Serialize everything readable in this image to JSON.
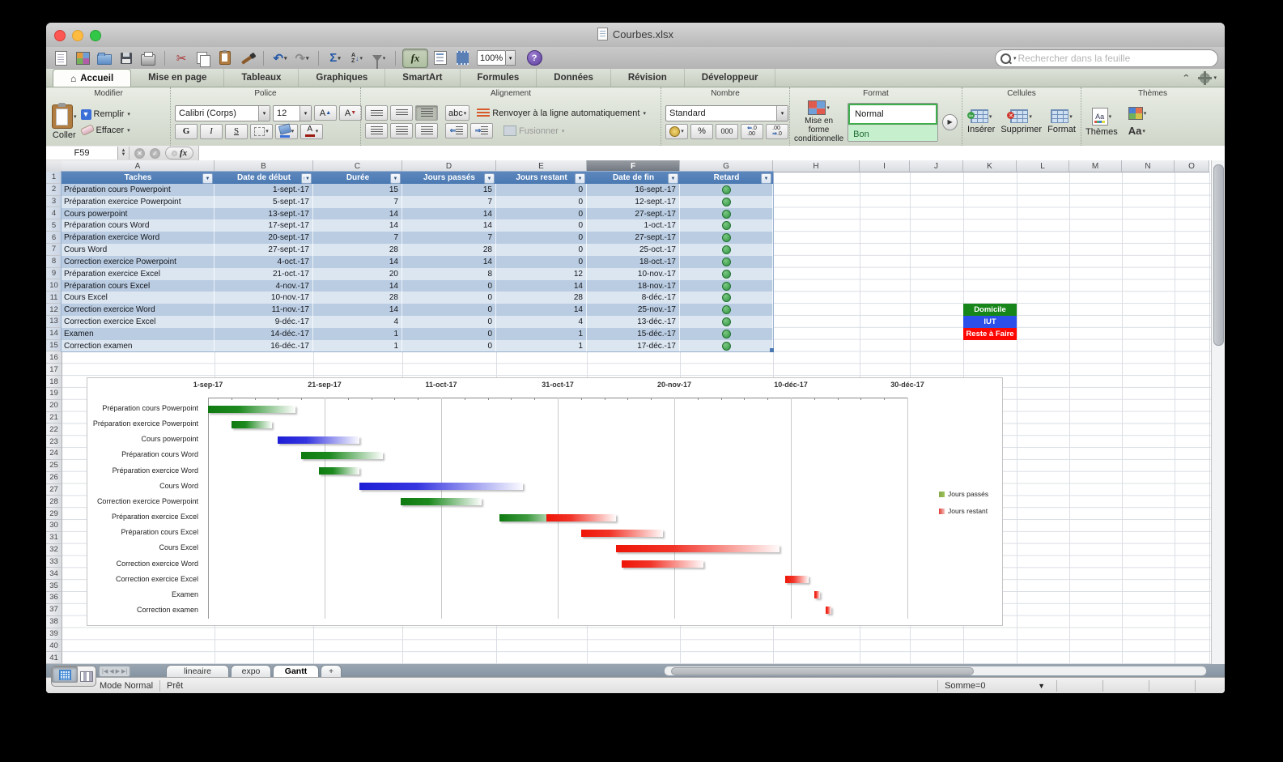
{
  "window": {
    "title": "Courbes.xlsx"
  },
  "toolbar": {
    "zoom_level": "100%",
    "search_placeholder": "Rechercher dans la feuille",
    "icons": {
      "cut": "✂",
      "undo": "↶",
      "redo": "↷",
      "autosum": "Σ",
      "fx": "fx",
      "help": "?",
      "sort_a": "A",
      "sort_z": "Z"
    }
  },
  "ribbon_tabs": {
    "items": [
      "Accueil",
      "Mise en page",
      "Tableaux",
      "Graphiques",
      "SmartArt",
      "Formules",
      "Données",
      "Révision",
      "Développeur"
    ],
    "active": "Accueil"
  },
  "ribbon": {
    "groups": {
      "modifier": {
        "label": "Modifier",
        "paste": "Coller",
        "fill": "Remplir",
        "clear": "Effacer"
      },
      "police": {
        "label": "Police",
        "font_name": "Calibri (Corps)",
        "font_size": "12",
        "bold": "G",
        "italic": "I",
        "underline": "S"
      },
      "alignement": {
        "label": "Alignement",
        "abc": "abc",
        "wrap": "Renvoyer à la ligne automatiquement",
        "merge": "Fusionner"
      },
      "nombre": {
        "label": "Nombre",
        "format": "Standard",
        "percent": "%",
        "thousands": "000"
      },
      "format": {
        "label": "Format",
        "cond_line1": "Mise en forme",
        "cond_line2": "conditionnelle",
        "style_normal": "Normal",
        "style_bon": "Bon"
      },
      "cellules": {
        "label": "Cellules",
        "insert": "Insérer",
        "delete": "Supprimer",
        "format": "Format"
      },
      "themes": {
        "label": "Thèmes",
        "themes": "Thèmes",
        "aa": "Aa"
      }
    }
  },
  "formula_bar": {
    "cell_ref": "F59",
    "fx": "fx"
  },
  "sheet": {
    "columns": [
      "A",
      "B",
      "C",
      "D",
      "E",
      "F",
      "G",
      "H",
      "I",
      "J",
      "K",
      "L",
      "M",
      "N",
      "O"
    ],
    "selected_column": "F",
    "visible_rows": 41,
    "table": {
      "headers": [
        "Taches",
        "Date de début",
        "Durée",
        "Jours passés",
        "Jours restant",
        "Date de fin",
        "Retard"
      ],
      "sorted_header_index": 1,
      "status_ok_color": "#2f9440",
      "rows": [
        [
          "Préparation cours Powerpoint",
          "1-sept.-17",
          "15",
          "15",
          "0",
          "16-sept.-17"
        ],
        [
          "Préparation exercice Powerpoint",
          "5-sept.-17",
          "7",
          "7",
          "0",
          "12-sept.-17"
        ],
        [
          "Cours powerpoint",
          "13-sept.-17",
          "14",
          "14",
          "0",
          "27-sept.-17"
        ],
        [
          "Préparation cours Word",
          "17-sept.-17",
          "14",
          "14",
          "0",
          "1-oct.-17"
        ],
        [
          "Préparation exercice Word",
          "20-sept.-17",
          "7",
          "7",
          "0",
          "27-sept.-17"
        ],
        [
          "Cours Word",
          "27-sept.-17",
          "28",
          "28",
          "0",
          "25-oct.-17"
        ],
        [
          "Correction exercice Powerpoint",
          "4-oct.-17",
          "14",
          "14",
          "0",
          "18-oct.-17"
        ],
        [
          "Préparation exercice Excel",
          "21-oct.-17",
          "20",
          "8",
          "12",
          "10-nov.-17"
        ],
        [
          "Préparation cours Excel",
          "4-nov.-17",
          "14",
          "0",
          "14",
          "18-nov.-17"
        ],
        [
          "Cours Excel",
          "10-nov.-17",
          "28",
          "0",
          "28",
          "8-déc.-17"
        ],
        [
          "Correction exercice Word",
          "11-nov.-17",
          "14",
          "0",
          "14",
          "25-nov.-17"
        ],
        [
          "Correction exercice Excel",
          "9-déc.-17",
          "4",
          "0",
          "4",
          "13-déc.-17"
        ],
        [
          "Examen",
          "14-déc.-17",
          "1",
          "0",
          "1",
          "15-déc.-17"
        ],
        [
          "Correction examen",
          "16-déc.-17",
          "1",
          "0",
          "1",
          "17-déc.-17"
        ]
      ]
    },
    "side_legend": [
      {
        "label": "Domicile",
        "color": "#17861a"
      },
      {
        "label": "IUT",
        "color": "#2b4fe8"
      },
      {
        "label": "Reste à Faire",
        "color": "#fd0703"
      }
    ]
  },
  "chart_data": {
    "type": "bar",
    "orientation": "horizontal-gantt",
    "title": "",
    "x_axis": {
      "tick_labels": [
        "1-sep-17",
        "21-sep-17",
        "11-oct-17",
        "31-oct-17",
        "20-nov-17",
        "10-déc-17",
        "30-déc-17"
      ],
      "tick_interval_days": 20,
      "minor_tick_days": 4,
      "span_days": 120,
      "position": "top"
    },
    "categories": [
      "Préparation cours Powerpoint",
      "Préparation exercice Powerpoint",
      "Cours powerpoint",
      "Préparation cours Word",
      "Préparation exercice Word",
      "Cours Word",
      "Correction exercice Powerpoint",
      "Préparation exercice Excel",
      "Préparation cours Excel",
      "Cours Excel",
      "Correction exercice Word",
      "Correction exercice Excel",
      "Examen",
      "Correction examen"
    ],
    "series": [
      {
        "name": "Jours passés",
        "values": [
          15,
          7,
          14,
          14,
          7,
          28,
          14,
          8,
          0,
          0,
          0,
          0,
          0,
          0
        ]
      },
      {
        "name": "Jours restant",
        "values": [
          0,
          0,
          0,
          0,
          0,
          0,
          0,
          12,
          14,
          28,
          14,
          4,
          1,
          1
        ]
      }
    ],
    "tasks": [
      {
        "label": "Préparation cours Powerpoint",
        "start_day": 0,
        "passed_days": 15,
        "remaining_days": 0,
        "passed_color": "green"
      },
      {
        "label": "Préparation exercice Powerpoint",
        "start_day": 4,
        "passed_days": 7,
        "remaining_days": 0,
        "passed_color": "green"
      },
      {
        "label": "Cours powerpoint",
        "start_day": 12,
        "passed_days": 14,
        "remaining_days": 0,
        "passed_color": "blue"
      },
      {
        "label": "Préparation cours Word",
        "start_day": 16,
        "passed_days": 14,
        "remaining_days": 0,
        "passed_color": "green"
      },
      {
        "label": "Préparation exercice Word",
        "start_day": 19,
        "passed_days": 7,
        "remaining_days": 0,
        "passed_color": "green"
      },
      {
        "label": "Cours Word",
        "start_day": 26,
        "passed_days": 28,
        "remaining_days": 0,
        "passed_color": "blue"
      },
      {
        "label": "Correction exercice Powerpoint",
        "start_day": 33,
        "passed_days": 14,
        "remaining_days": 0,
        "passed_color": "green"
      },
      {
        "label": "Préparation exercice Excel",
        "start_day": 50,
        "passed_days": 8,
        "remaining_days": 12,
        "passed_color": "green"
      },
      {
        "label": "Préparation cours Excel",
        "start_day": 64,
        "passed_days": 0,
        "remaining_days": 14,
        "passed_color": null
      },
      {
        "label": "Cours Excel",
        "start_day": 70,
        "passed_days": 0,
        "remaining_days": 28,
        "passed_color": null
      },
      {
        "label": "Correction exercice Word",
        "start_day": 71,
        "passed_days": 0,
        "remaining_days": 14,
        "passed_color": null
      },
      {
        "label": "Correction exercice Excel",
        "start_day": 99,
        "passed_days": 0,
        "remaining_days": 4,
        "passed_color": null
      },
      {
        "label": "Examen",
        "start_day": 104,
        "passed_days": 0,
        "remaining_days": 1,
        "passed_color": null
      },
      {
        "label": "Correction examen",
        "start_day": 106,
        "passed_days": 0,
        "remaining_days": 1,
        "passed_color": null
      }
    ],
    "bar_colors": {
      "green": "#0e7a10",
      "blue": "#1d1dd6",
      "red": "#ee1507"
    },
    "legend": [
      {
        "label": "Jours passés",
        "swatch": "#9cc357"
      },
      {
        "label": "Jours restant",
        "swatch": "#e23b36"
      }
    ],
    "legend_position": "right",
    "gridlines": true
  },
  "sheet_tabs": {
    "tabs": [
      "lineaire",
      "expo",
      "Gantt"
    ],
    "active": "Gantt",
    "add_label": "+"
  },
  "status_bar": {
    "mode": "Mode Normal",
    "state": "Prêt",
    "sum": "Somme=0"
  }
}
